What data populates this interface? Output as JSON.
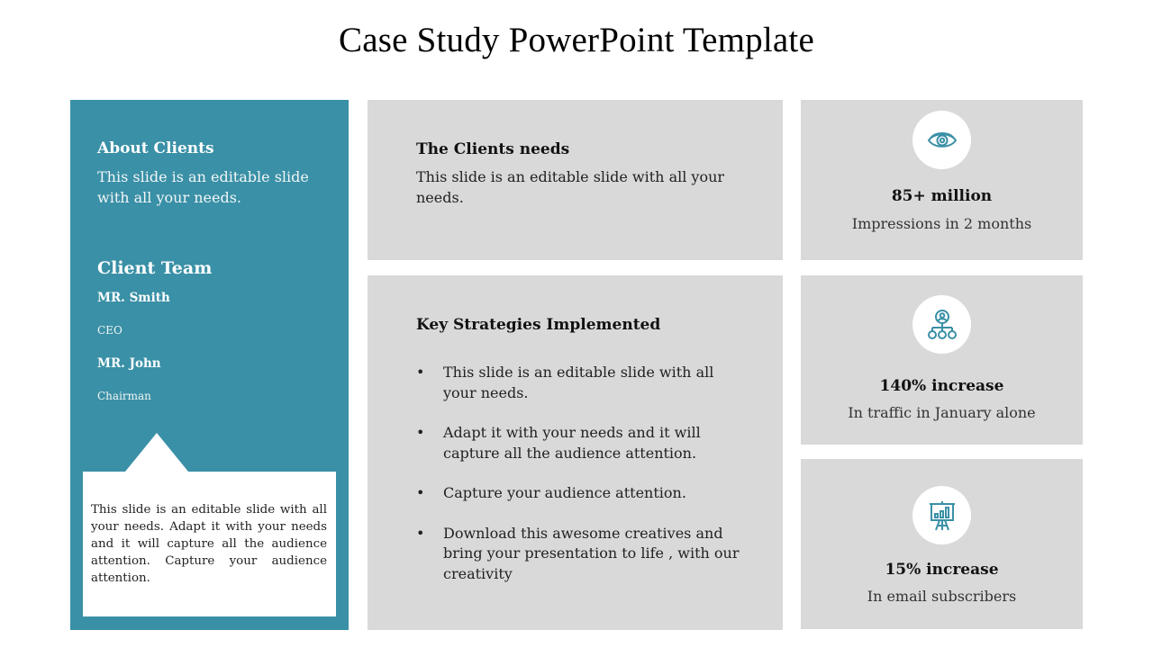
{
  "title": "Case Study PowerPoint Template",
  "colors": {
    "teal": "#3A90A6",
    "gray": "#D9D9D9",
    "icon": "#3A90A6"
  },
  "about": {
    "heading": "About Clients",
    "text": "This slide is an editable slide with all your needs."
  },
  "team": {
    "heading": "Client Team",
    "members": [
      {
        "name": "MR. Smith",
        "role": "CEO"
      },
      {
        "name": "MR. John",
        "role": "Chairman"
      }
    ]
  },
  "callout": {
    "text": "This slide is an editable slide with all your needs. Adapt it with your needs and it will capture all the audience attention. Capture your audience attention."
  },
  "needs": {
    "heading": "The Clients needs",
    "text": "This slide is an editable slide with all your needs."
  },
  "strategies": {
    "heading": "Key Strategies Implemented",
    "bullet_glyph": "•",
    "items": [
      "This slide is an editable slide with all your needs.",
      "Adapt it with your needs and it will capture all the audience attention.",
      "Capture your audience attention.",
      "Download this awesome creatives and bring your presentation to life , with our creativity"
    ]
  },
  "stats": [
    {
      "icon": "eye-icon",
      "value": "85+ million",
      "label": "Impressions in 2 months"
    },
    {
      "icon": "org-chart-icon",
      "value": "140% increase",
      "label": "In traffic in January alone"
    },
    {
      "icon": "presentation-chart-icon",
      "value": "15% increase",
      "label": "In email subscribers"
    }
  ]
}
